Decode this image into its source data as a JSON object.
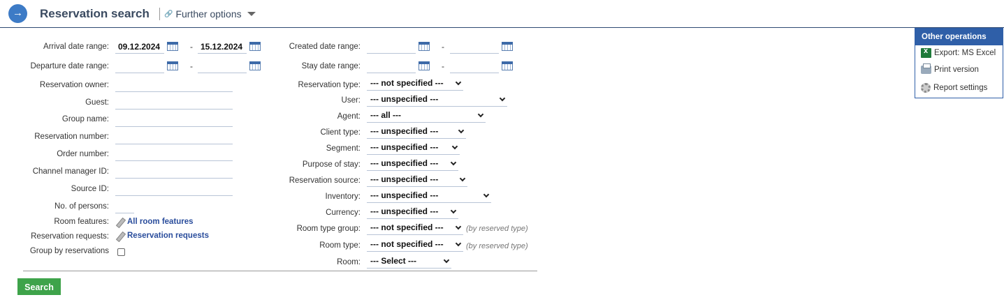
{
  "header": {
    "title": "Reservation search",
    "further_options": "Further options",
    "link_icon": "🔗"
  },
  "left": {
    "arrival_label": "Arrival date range:",
    "arrival_from": "09.12.2024",
    "arrival_to": "15.12.2024",
    "departure_label": "Departure date range:",
    "departure_from": "",
    "departure_to": "",
    "owner_label": "Reservation owner:",
    "guest_label": "Guest:",
    "group_label": "Group name:",
    "resnum_label": "Reservation number:",
    "ordernum_label": "Order number:",
    "channel_label": "Channel manager ID:",
    "source_label": "Source ID:",
    "persons_label": "No. of persons:",
    "features_label": "Room features:",
    "features_link": "All room features",
    "requests_label": "Reservation requests:",
    "requests_link": "Reservation requests",
    "groupby_label": "Group by reservations",
    "dash": "-"
  },
  "right": {
    "created_label": "Created date range:",
    "stay_label": "Stay date range:",
    "restype_label": "Reservation type:",
    "restype_value": "--- not specified ---",
    "user_label": "User:",
    "user_value": "--- unspecified ---",
    "agent_label": "Agent:",
    "agent_value": "--- all ---",
    "clienttype_label": "Client type:",
    "clienttype_value": "--- unspecified ---",
    "segment_label": "Segment:",
    "segment_value": "--- unspecified ---",
    "purpose_label": "Purpose of stay:",
    "purpose_value": "--- unspecified ---",
    "ressource_label": "Reservation source:",
    "ressource_value": "--- unspecified ---",
    "inventory_label": "Inventory:",
    "inventory_value": "--- unspecified ---",
    "currency_label": "Currency:",
    "currency_value": "--- unspecified ---",
    "rtgroup_label": "Room type group:",
    "rtgroup_value": "--- not specified ---",
    "rtgroup_note": "(by reserved type)",
    "roomtype_label": "Room type:",
    "roomtype_value": "--- not specified ---",
    "roomtype_note": "(by reserved type)",
    "room_label": "Room:",
    "room_value": "--- Select ---"
  },
  "search_button": "Search",
  "other_ops": {
    "title": "Other operations",
    "excel": "Export: MS Excel",
    "print": "Print version",
    "settings": "Report settings"
  }
}
